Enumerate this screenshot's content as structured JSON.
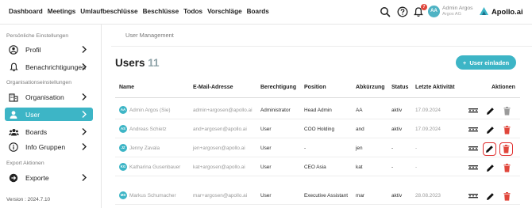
{
  "topnav": {
    "items": [
      "Dashboard",
      "Meetings",
      "Umlaufbeschlüsse",
      "Beschlüsse",
      "Todos",
      "Vorschläge",
      "Boards"
    ],
    "notifications_count": "7",
    "user_initials": "AA",
    "user_name": "Admin Argos",
    "user_org": "Argos AG",
    "logo_text": "Apollo.ai"
  },
  "sidebar": {
    "section_personal": "Persönliche Einstellungen",
    "section_org": "Organisationseinstellungen",
    "section_export": "Export Aktionen",
    "items": [
      {
        "label": "Profil",
        "icon": "account-circle-icon"
      },
      {
        "label": "Benachrichtigungen",
        "icon": "bell-icon"
      },
      {
        "label": "Organisation",
        "icon": "building-icon"
      },
      {
        "label": "User",
        "icon": "person-icon",
        "active": true
      },
      {
        "label": "Boards",
        "icon": "group-icon"
      },
      {
        "label": "Info Gruppen",
        "icon": "info-icon"
      },
      {
        "label": "Exporte",
        "icon": "export-icon"
      }
    ],
    "version": "Version : 2024.7.10"
  },
  "main": {
    "tab": "User Management",
    "title": "Users",
    "count": "11",
    "invite_label": "User einladen",
    "columns": [
      "Name",
      "E-Mail-Adresse",
      "Berechtigung",
      "Position",
      "Abkürzung",
      "Status",
      "Letzte Aktivität",
      "Aktionen"
    ],
    "rows": [
      {
        "initials": "AA",
        "name": "Admin Argos (Sie)",
        "email": "admin+argosen@apollo.ai",
        "role": "Administrator",
        "position": "Head Admin",
        "abbr": "AA",
        "status": "aktiv",
        "last": "17.09.2024"
      },
      {
        "initials": "AS",
        "name": "Andreas Schietz",
        "email": "and+argosen@apollo.ai",
        "role": "User",
        "position": "COO Holding",
        "abbr": "and",
        "status": "aktiv",
        "last": "17.09.2024"
      },
      {
        "initials": "JZ",
        "name": "Jenny Zavala",
        "email": "jen+argosen@apollo.ai",
        "role": "User",
        "position": "-",
        "abbr": "jen",
        "status": "-",
        "last": "-"
      },
      {
        "initials": "KG",
        "name": "Katharina Gusenbauer",
        "email": "kat+argosen@apollo.ai",
        "role": "User",
        "position": "CEO Asia",
        "abbr": "kat",
        "status": "-",
        "last": "-"
      },
      {
        "initials": "MS",
        "name": "Markus Schumacher",
        "email": "mar+argosen@apollo.ai",
        "role": "User",
        "position": "Executive Assistant",
        "abbr": "mar",
        "status": "aktiv",
        "last": "28.08.2023"
      }
    ],
    "colors": {
      "accent": "#3db5c6",
      "delete": "#e0463b",
      "highlight": "#e02d2d"
    }
  }
}
